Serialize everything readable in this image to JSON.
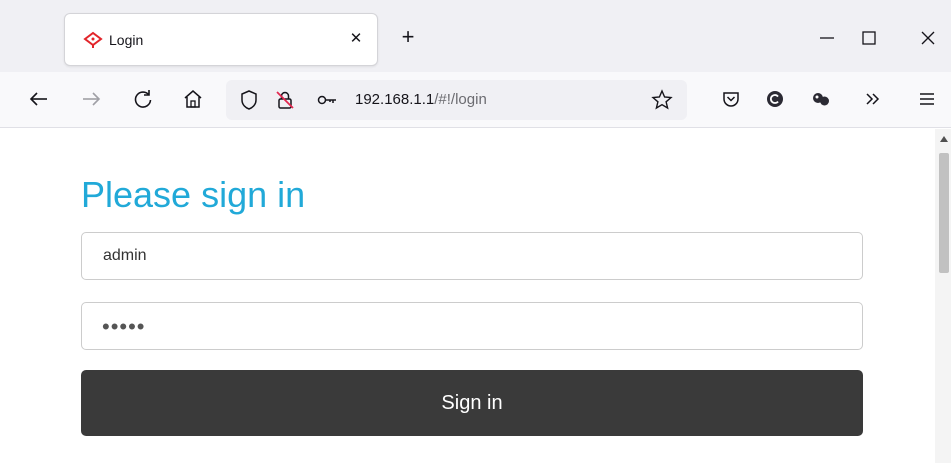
{
  "browser": {
    "tab": {
      "title": "Login"
    },
    "new_tab_symbol": "+",
    "close_symbol": "✕",
    "url": {
      "host": "192.168.1.1",
      "path": "/#!/login"
    }
  },
  "page": {
    "heading": "Please sign in",
    "username": {
      "value": "admin"
    },
    "password": {
      "masked": "•••••"
    },
    "sign_in_label": "Sign in"
  },
  "colors": {
    "heading": "#21a9d8",
    "button_bg": "#3a3a3a",
    "favicon": "#e2242a"
  }
}
